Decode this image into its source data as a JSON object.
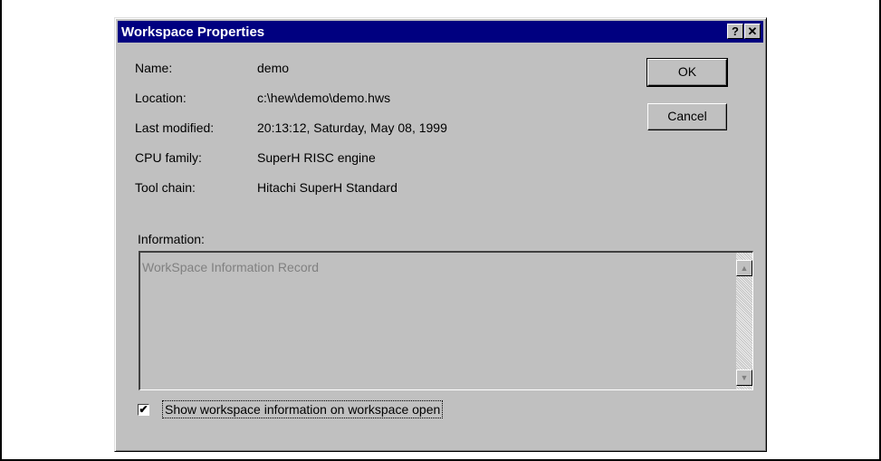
{
  "dialog": {
    "title": "Workspace Properties",
    "help_glyph": "?",
    "close_glyph": "✕"
  },
  "properties": [
    {
      "label": "Name:",
      "value": "demo"
    },
    {
      "label": "Location:",
      "value": "c:\\hew\\demo\\demo.hws"
    },
    {
      "label": "Last modified:",
      "value": "20:13:12, Saturday, May 08, 1999"
    },
    {
      "label": "CPU family:",
      "value": "SuperH RISC engine"
    },
    {
      "label": "Tool chain:",
      "value": "Hitachi SuperH Standard"
    }
  ],
  "buttons": {
    "ok": "OK",
    "cancel": "Cancel"
  },
  "information": {
    "label": "Information:",
    "text": "WorkSpace Information Record",
    "scroll_up_glyph": "▲",
    "scroll_down_glyph": "▼"
  },
  "show_info": {
    "label": "Show workspace information on workspace open",
    "checked": true,
    "check_glyph": "✔"
  },
  "icons": [
    "help-icon",
    "close-icon",
    "scroll-up-arrow-icon",
    "scroll-down-arrow-icon",
    "checkmark-icon"
  ]
}
